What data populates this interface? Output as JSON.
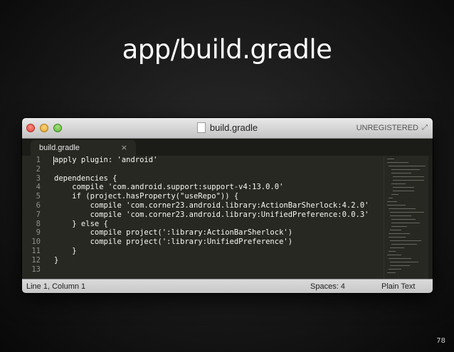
{
  "slide": {
    "title": "app/build.gradle",
    "page_number": "78"
  },
  "window": {
    "title": "build.gradle",
    "license_status": "UNREGISTERED",
    "tab": {
      "label": "build.gradle",
      "close_glyph": "×"
    },
    "status": {
      "position": "Line 1, Column 1",
      "indentation": "Spaces: 4",
      "syntax": "Plain Text"
    }
  },
  "editor": {
    "line_numbers": [
      "1",
      "2",
      "3",
      "4",
      "5",
      "6",
      "7",
      "8",
      "9",
      "10",
      "11",
      "12",
      "13"
    ],
    "lines": [
      "apply plugin: 'android'",
      "",
      "dependencies {",
      "    compile 'com.android.support:support-v4:13.0.0'",
      "    if (project.hasProperty(\"useRepo\")) {",
      "        compile 'com.corner23.android.library:ActionBarSherlock:4.2.0'",
      "        compile 'com.corner23.android.library:UnifiedPreference:0.0.3'",
      "    } else {",
      "        compile project(':library:ActionBarSherlock')",
      "        compile project(':library:UnifiedPreference')",
      "    }",
      "}",
      ""
    ]
  },
  "icons": {
    "document": "document-icon",
    "fullscreen": "fullscreen-icon"
  },
  "colors": {
    "editor_background": "#272822",
    "editor_text": "#f8f8f2",
    "gutter_text": "#8f908a",
    "close_button": "#e0443b",
    "minimize_button": "#e0a52c",
    "zoom_button": "#5ab83a"
  }
}
